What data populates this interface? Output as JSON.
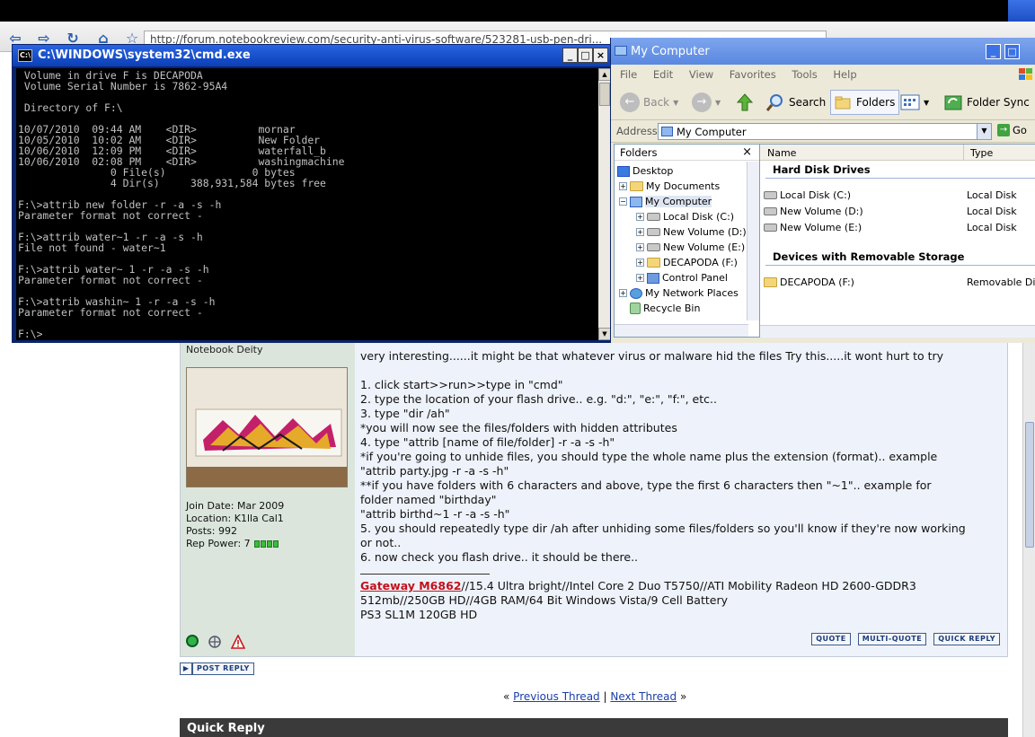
{
  "browser": {
    "url": "http://forum.notebookreview.com/security-anti-virus-software/523281-usb-pen-dri..."
  },
  "cmd": {
    "title": "C:\\WINDOWS\\system32\\cmd.exe",
    "lines": [
      " Volume in drive F is DECAPODA",
      " Volume Serial Number is 7862-95A4",
      "",
      " Directory of F:\\",
      "",
      "10/07/2010  09:44 AM    <DIR>          mornar",
      "10/05/2010  10:02 AM    <DIR>          New Folder",
      "10/06/2010  12:09 PM    <DIR>          waterfall_b",
      "10/06/2010  02:08 PM    <DIR>          washingmachine",
      "               0 File(s)              0 bytes",
      "               4 Dir(s)     388,931,584 bytes free",
      "",
      "F:\\>attrib new folder -r -a -s -h",
      "Parameter format not correct -",
      "",
      "F:\\>attrib water~1 -r -a -s -h",
      "File not found - water~1",
      "",
      "F:\\>attrib water~ 1 -r -a -s -h",
      "Parameter format not correct -",
      "",
      "F:\\>attrib washin~ 1 -r -a -s -h",
      "Parameter format not correct -",
      "",
      "F:\\>"
    ]
  },
  "explorer": {
    "title": "My Computer",
    "menu": [
      "File",
      "Edit",
      "View",
      "Favorites",
      "Tools",
      "Help"
    ],
    "toolbar": {
      "back": "Back",
      "search": "Search",
      "folders": "Folders",
      "folder_sync": "Folder Sync"
    },
    "address_label": "Address",
    "address_value": "My Computer",
    "go_label": "Go",
    "folders_header": "Folders",
    "tree": [
      "Desktop",
      "My Documents",
      "My Computer",
      "Local Disk (C:)",
      "New Volume (D:)",
      "New Volume (E:)",
      "DECAPODA (F:)",
      "Control Panel",
      "My Network Places",
      "Recycle Bin"
    ],
    "columns": {
      "name": "Name",
      "type": "Type"
    },
    "group_hdd": "Hard Disk Drives",
    "drives": [
      {
        "name": "Local Disk (C:)",
        "type": "Local Disk"
      },
      {
        "name": "New Volume (D:)",
        "type": "Local Disk"
      },
      {
        "name": "New Volume (E:)",
        "type": "Local Disk"
      }
    ],
    "group_removable": "Devices with Removable Storage",
    "removable": [
      {
        "name": "DECAPODA (F:)",
        "type": "Removable Disk"
      }
    ]
  },
  "post": {
    "rank": "Notebook Deity",
    "join_date": "Join Date: Mar 2009",
    "location": "Location: K1lla Cal1",
    "posts": "Posts: 992",
    "rep_power": "Rep Power: 7",
    "rep_pips": 4,
    "body": [
      "very interesting......it might be that whatever virus or malware hid the files Try this.....it wont hurt to try",
      "",
      "1. click start>>run>>type in \"cmd\"",
      "2. type the location of your flash drive.. e.g. \"d:\", \"e:\", \"f:\", etc..",
      "3. type \"dir /ah\"",
      "*you will now see the files/folders with hidden attributes",
      "4. type \"attrib [name of file/folder] -r -a -s -h\"",
      "*if you're going to unhide files, you should type the whole name plus the extension (format).. example",
      "\"attrib party.jpg -r -a -s -h\"",
      "**if you have folders with 6 characters and above, type the first 6 characters then \"~1\".. example for",
      "folder named \"birthday\"",
      "\"attrib birthd~1 -r -a -s -h\"",
      "5. you should repeatedly type dir /ah after unhiding some files/folders so you'll know if they're now working",
      "or not..",
      "6. now check you flash drive.. it should be there.."
    ],
    "sig_brand": "Gateway M6862",
    "sig_line1": "//15.4 Ultra bright//Intel Core 2 Duo T5750//ATI Mobility Radeon HD 2600-GDDR3",
    "sig_line2": "512mb//250GB HD//4GB RAM/64 Bit Windows Vista/9 Cell Battery",
    "sig_line3": "PS3 SL1M 120GB HD",
    "buttons": {
      "quote": "QUOTE",
      "multi_quote": "MULTI-QUOTE",
      "quick_reply": "QUICK REPLY"
    }
  },
  "post_reply_label": "POST REPLY",
  "thread_nav": {
    "prev": "Previous Thread",
    "sep": "|",
    "next": "Next Thread",
    "open": "«",
    "close": "»"
  },
  "quick_reply_title": "Quick Reply"
}
